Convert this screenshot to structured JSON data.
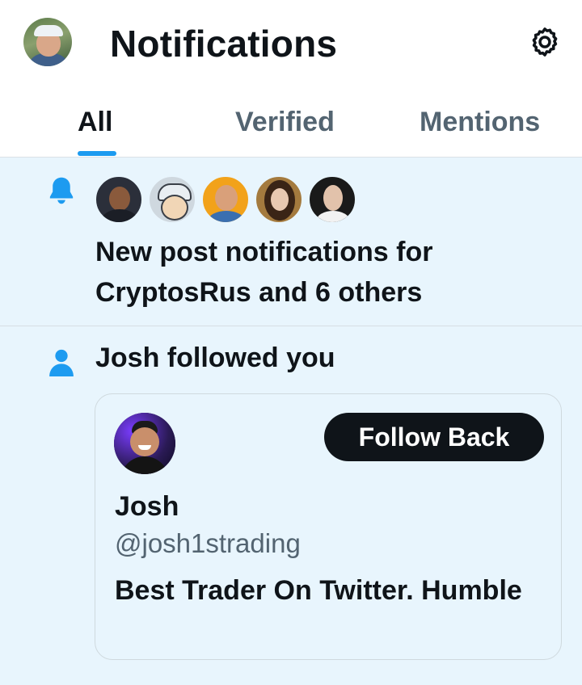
{
  "header": {
    "title": "Notifications",
    "settings_icon": "gear-icon"
  },
  "tabs": [
    {
      "label": "All",
      "active": true
    },
    {
      "label": "Verified",
      "active": false
    },
    {
      "label": "Mentions",
      "active": false
    }
  ],
  "colors": {
    "accent": "#1d9bf0",
    "highlight_bg": "#e8f5fd",
    "text_primary": "#0f1419",
    "text_secondary": "#536471"
  },
  "notifications": [
    {
      "type": "new-post-subscription",
      "icon": "bell-icon",
      "text": "New post notifications for CryptosRus and 6 others"
    },
    {
      "type": "follow",
      "icon": "person-icon",
      "text": "Josh followed you",
      "card": {
        "name": "Josh",
        "handle": "@josh1strading",
        "bio": "Best Trader On Twitter. Humble",
        "follow_back_label": "Follow Back"
      }
    }
  ]
}
